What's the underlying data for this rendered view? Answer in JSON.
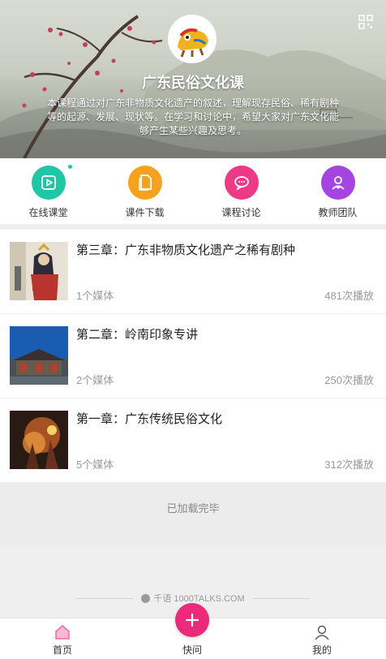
{
  "header": {
    "title": "广东民俗文化课",
    "description": "本课程通过对广东非物质文化遗产的叙述，理解现存民俗、稀有剧种等的起源、发展、现状等。在学习和讨论中，希望大家对广东文化能够产生某些兴趣及思考。"
  },
  "menu": [
    {
      "label": "在线课堂",
      "icon": "video-icon",
      "color": "#21c6a5"
    },
    {
      "label": "课件下载",
      "icon": "document-icon",
      "color": "#f6a21e"
    },
    {
      "label": "课程讨论",
      "icon": "chat-icon",
      "color": "#ee3a86"
    },
    {
      "label": "教师团队",
      "icon": "teacher-icon",
      "color": "#a544e0"
    }
  ],
  "chapters": [
    {
      "title": "第三章：广东非物质文化遗产之稀有剧种",
      "media": "1个媒体",
      "plays": "481次播放"
    },
    {
      "title": "第二章：岭南印象专讲",
      "media": "2个媒体",
      "plays": "250次播放"
    },
    {
      "title": "第一章：广东传统民俗文化",
      "media": "5个媒体",
      "plays": "312次播放"
    }
  ],
  "loaded_text": "已加载完毕",
  "brand_text": "千语 1000TALKS.COM",
  "tabbar": {
    "home": "首页",
    "quick_ask": "快问",
    "mine": "我的"
  },
  "colors": {
    "accent": "#ec2a7c",
    "home_icon": "#f06aa0"
  }
}
